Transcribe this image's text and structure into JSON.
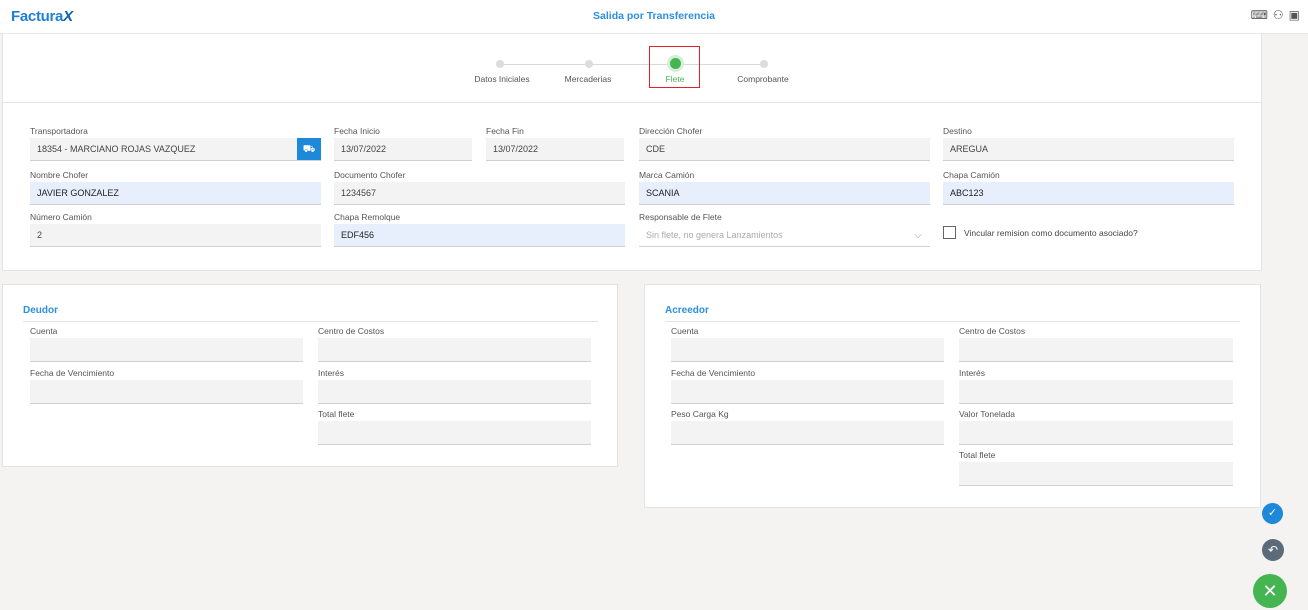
{
  "app": {
    "logo_text": "Factura",
    "logo_x": "X",
    "title": "Salida por Transferencia"
  },
  "header_icons": [
    "keyboard-icon",
    "users-icon",
    "screen-icon"
  ],
  "steps": [
    {
      "label": "Datos Iniciales",
      "active": false
    },
    {
      "label": "Mercaderias",
      "active": false
    },
    {
      "label": "Flete",
      "active": true
    },
    {
      "label": "Comprobante",
      "active": false
    }
  ],
  "form": {
    "transportadora": {
      "label": "Transportadora",
      "value": "18354 - MARCIANO ROJAS VAZQUEZ"
    },
    "fecha_inicio": {
      "label": "Fecha Inicio",
      "value": "13/07/2022"
    },
    "fecha_fin": {
      "label": "Fecha Fin",
      "value": "13/07/2022"
    },
    "direccion_chofer": {
      "label": "Dirección Chofer",
      "value": "CDE"
    },
    "destino": {
      "label": "Destino",
      "value": "AREGUA"
    },
    "nombre_chofer": {
      "label": "Nombre Chofer",
      "value": "JAVIER GONZALEZ"
    },
    "documento_chofer": {
      "label": "Documento Chofer",
      "value": "1234567"
    },
    "marca_camion": {
      "label": "Marca Camión",
      "value": "SCANIA"
    },
    "chapa_camion": {
      "label": "Chapa Camión",
      "value": "ABC123"
    },
    "numero_camion": {
      "label": "Número Camión",
      "value": "2"
    },
    "chapa_remolque": {
      "label": "Chapa Remolque",
      "value": "EDF456"
    },
    "responsable_flete": {
      "label": "Responsable de Flete",
      "value": "Sin flete, no genera Lanzamientos"
    },
    "vincular": {
      "label": "Vincular remision como documento asociado?",
      "checked": false
    }
  },
  "deudor": {
    "title": "Deudor",
    "cuenta": "Cuenta",
    "centro_costos": "Centro de Costos",
    "fecha_vencimiento": "Fecha de Vencimiento",
    "interes": "Interés",
    "total_flete": "Total flete"
  },
  "acreedor": {
    "title": "Acreedor",
    "cuenta": "Cuenta",
    "centro_costos": "Centro de Costos",
    "fecha_vencimiento": "Fecha de Vencimiento",
    "interes": "Interés",
    "peso_carga": "Peso Carga Kg",
    "valor_tonelada": "Valor Tonelada",
    "total_flete": "Total flete"
  },
  "actions": {
    "confirm_glyph": "✓",
    "back_glyph": "↶",
    "close_glyph": "✕"
  },
  "colors": {
    "accent": "#1e88d9",
    "success": "#45b552",
    "highlight": "#e0232b"
  }
}
